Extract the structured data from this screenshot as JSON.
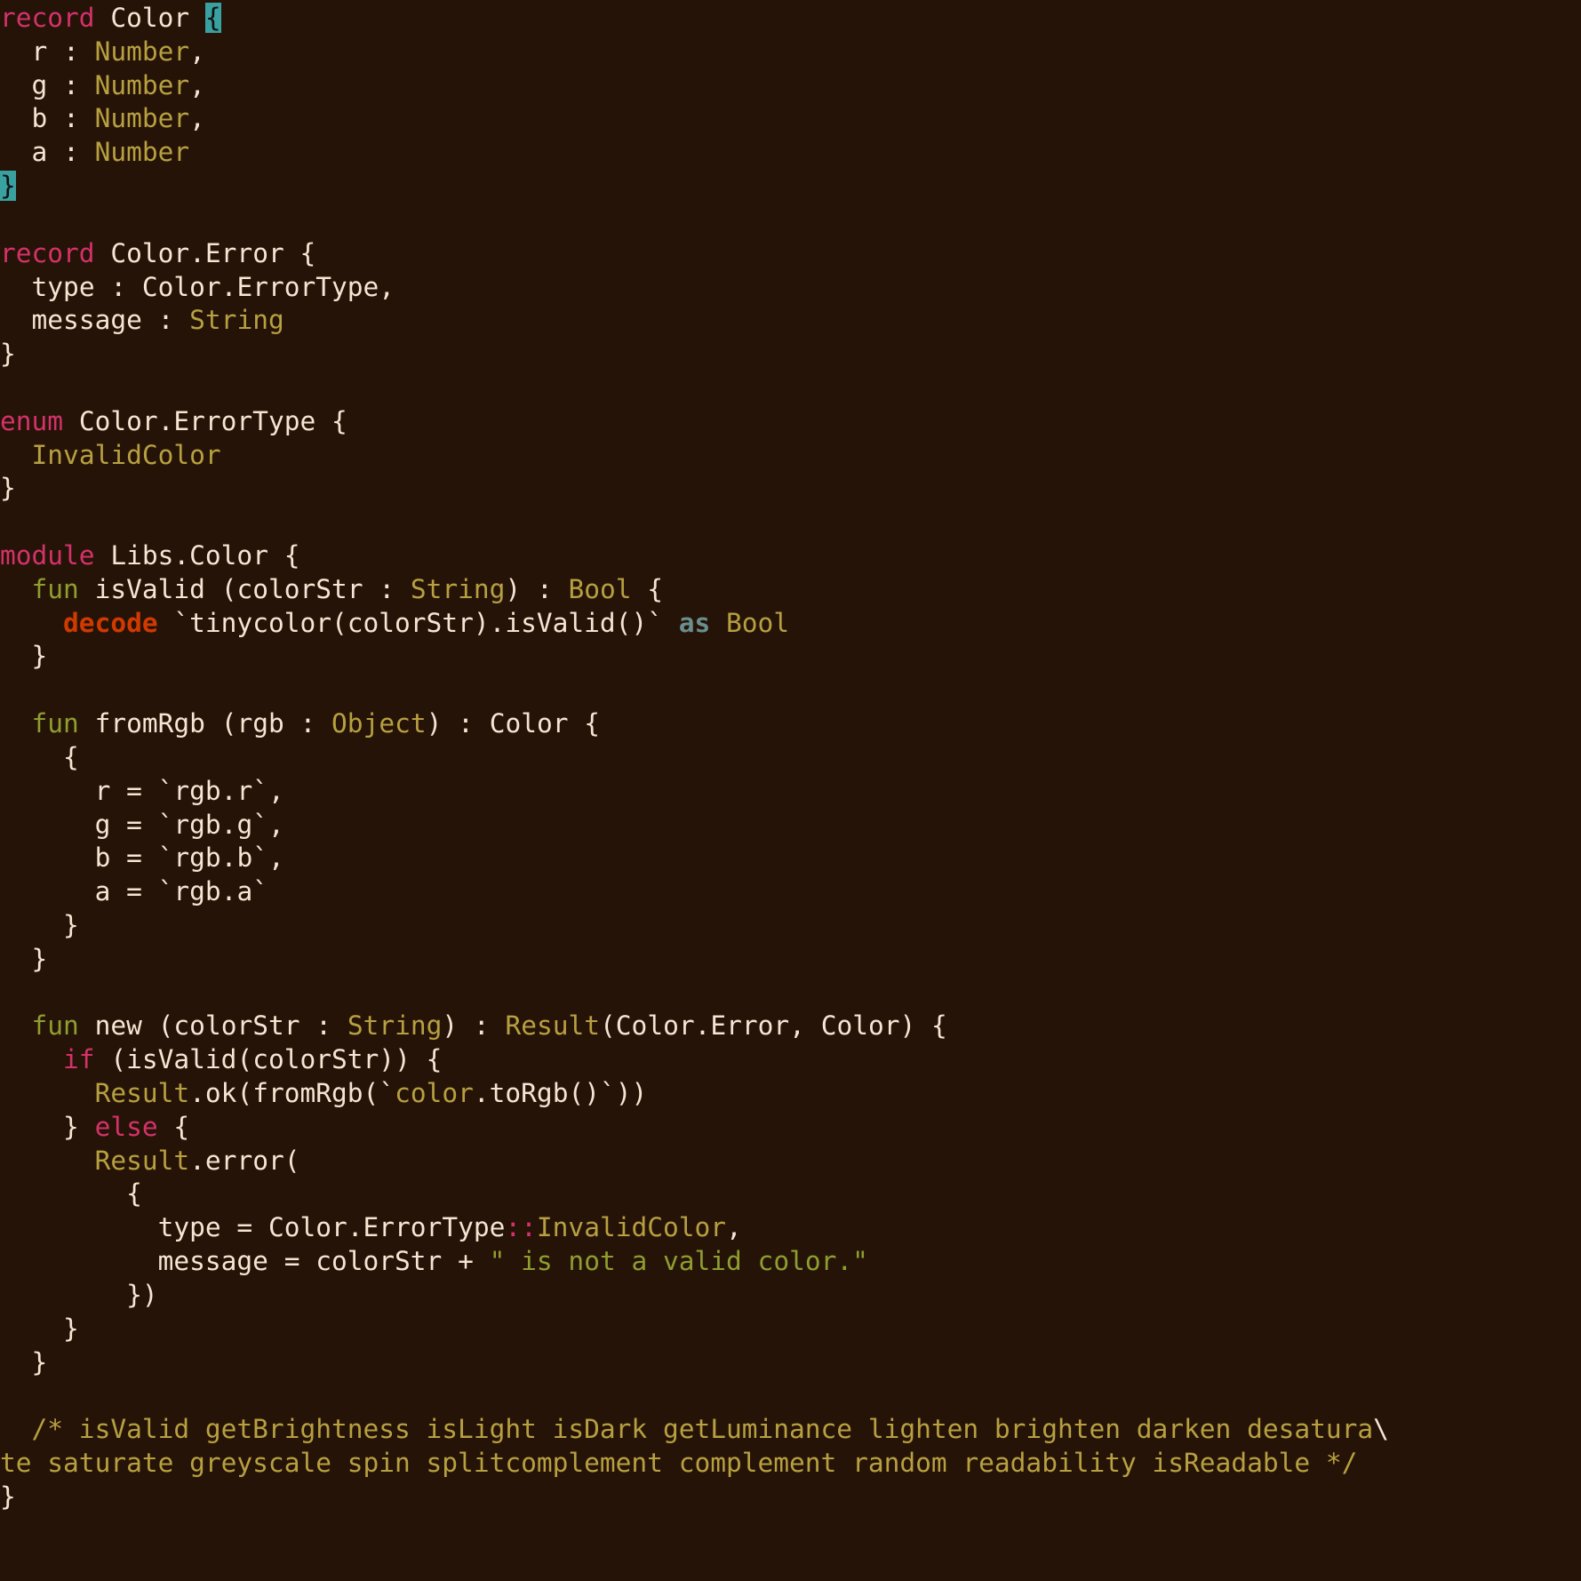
{
  "language": "mint",
  "theme": {
    "background": "#261307",
    "foreground": "#f5e5d3",
    "keyword": "#d3326a",
    "type": "#b7a040",
    "function_kw": "#8e9e2f",
    "decode": "#d03a00",
    "as": "#6a8f8f",
    "string": "#8e9e2f",
    "comment": "#b7a040",
    "match_highlight_bg": "#3aa1a1"
  },
  "tokens": {
    "record": "record",
    "enum": "enum",
    "module": "module",
    "fun": "fun",
    "if": "if",
    "else": "else",
    "decode": "decode",
    "as": "as",
    "Color": "Color",
    "ColorError": "Color.Error",
    "ColorErrorType": "Color.ErrorType",
    "LibsColor": "Libs.Color",
    "Number": "Number",
    "String": "String",
    "Bool": "Bool",
    "Object": "Object",
    "Result": "Result",
    "InvalidColor": "InvalidColor",
    "isValid": "isValid",
    "fromRgb": "fromRgb",
    "new": "new",
    "colorStr": "colorStr",
    "rgb": "rgb",
    "r": "r",
    "g": "g",
    "b": "b",
    "a": "a",
    "type_field": "type",
    "message": "message",
    "tinycolor_isValid": "`tinycolor(colorStr).isValid()`",
    "rgb_r": "`rgb.r`",
    "rgb_g": "`rgb.g`",
    "rgb_b": "`rgb.b`",
    "rgb_a": "`rgb.a`",
    "color_toRgb": "`color.toRgb()`",
    "toRgb_tail": ".toRgb()`",
    "color_word": "color",
    "ok": "ok",
    "error": "error",
    "err_string": "\" is not a valid color.\"",
    "dcolon": "::",
    "lbrace": "{",
    "rbrace": "}",
    "lparen": "(",
    "rparen": ")",
    "colon": ":",
    "comma": ",",
    "eq": "=",
    "plus": "+",
    "backslash": "\\",
    "comment_l1": "  /* isValid getBrightness isLight isDark getLuminance lighten brighten darken desatura",
    "comment_l2": "te saturate greyscale spin splitcomplement complement random readability isReadable */"
  }
}
